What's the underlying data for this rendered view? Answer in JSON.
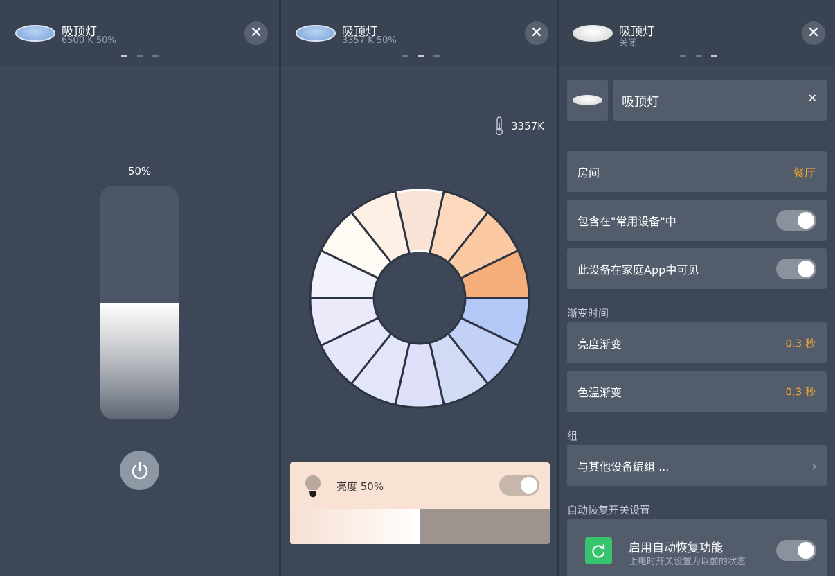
{
  "panels": [
    {
      "title": "吸顶灯",
      "subtitle": "6500 K 50%",
      "close": "✕",
      "brightness_label": "50%",
      "brightness_level": 0.5,
      "lamp_color": "#8db3e3"
    },
    {
      "title": "吸顶灯",
      "subtitle": "3357 K 50%",
      "close": "✕",
      "color_temp_readout": "3357K",
      "brightness_card": {
        "label": "亮度 50%",
        "level": 0.5,
        "toggle_on": true
      },
      "wheel_colors": {
        "outer": [
          "#f8e3d6",
          "#fdd8bc",
          "#fbc9a2",
          "#f5ad79",
          "#b4c8f8",
          "#c4d1f6",
          "#d2daf6",
          "#dde0f8",
          "#e3e5f9",
          "#e6e6fa",
          "#eceafa",
          "#f1f1fb",
          "#fdfbf3",
          "#fef0e4"
        ],
        "selected_index": 0
      }
    },
    {
      "title": "吸顶灯",
      "subtitle": "关闭",
      "close": "✕",
      "name_field": {
        "value": "吸顶灯",
        "clear": "✕"
      },
      "room": {
        "label": "房间",
        "value": "餐厅"
      },
      "favorites": {
        "label": "包含在\"常用设备\"中",
        "on": true
      },
      "visible_in_home": {
        "label": "此设备在家庭App中可见",
        "on": true
      },
      "transition_section": "渐变时间",
      "brightness_transition": {
        "label": "亮度渐变",
        "value": "0.3 秒"
      },
      "color_transition": {
        "label": "色温渐变",
        "value": "0.3 秒"
      },
      "group_section": "组",
      "group_row": {
        "label": "与其他设备编组 ...",
        "chevron": "›"
      },
      "auto_section": "自动恢复开关设置",
      "auto_restore": {
        "title": "启用自动恢复功能",
        "subtitle": "上电时开关设置为以前的状态",
        "on": true
      }
    }
  ],
  "colors": {
    "accent_orange": "#f2a531",
    "toggle_green": "#36c46e",
    "panel_bg": "#3d4757"
  }
}
